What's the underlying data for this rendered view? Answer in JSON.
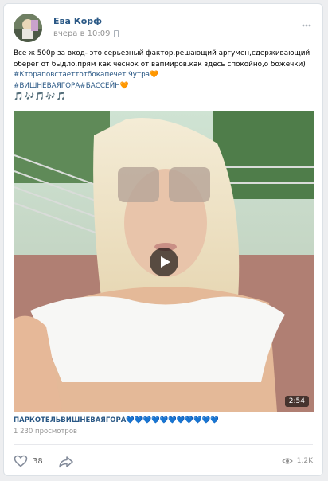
{
  "post": {
    "author": "Ева Корф",
    "time": "вчера в 10:09",
    "text_line1": "Все ж 500р за вход- это серьезный фактор,решающий аргумен,сдерживающий",
    "text_line2": "оберег от быдло.прям как чеснок от вапмиров.как здесь спокойно,о божечки)",
    "hashtag1": "#Ктораповстаеттотбокапечет 9утра🧡",
    "hashtag2": "#ВИШНЕВАЯГОРА#БАССЕЙН🧡",
    "music_notes": "🎵🎶🎵🎶🎵"
  },
  "video": {
    "duration": "2:54",
    "title": "ПАРКОТЕЛЬВИШНЕВАЯГОРА💙💙💙💙💙💙💙💙💙💙💙",
    "views": "1 230 просмотров"
  },
  "actions": {
    "likes": "38",
    "view_count": "1.2K"
  },
  "colors": {
    "link": "#2a5885",
    "meta": "#939393",
    "background": "#edeef0"
  },
  "icons": [
    "more-icon",
    "mobile-icon",
    "play-icon",
    "heart-icon",
    "share-icon",
    "eye-icon"
  ]
}
